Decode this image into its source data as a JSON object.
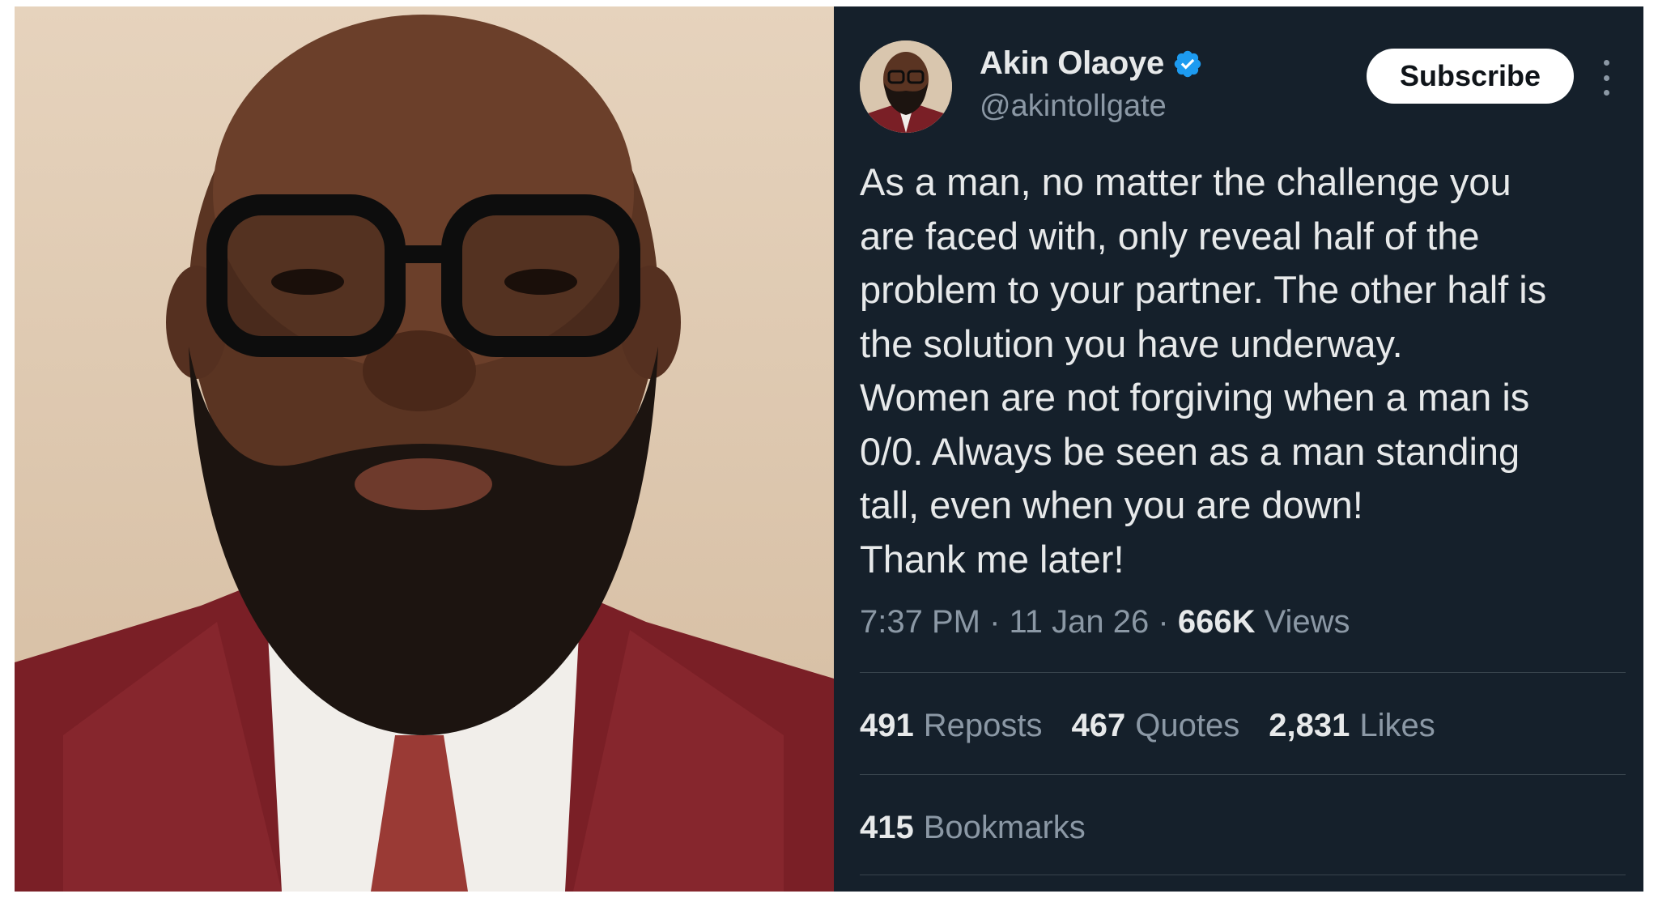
{
  "author": {
    "display_name": "Akin Olaoye",
    "handle": "@akintollgate",
    "verified_icon": "verified-badge-icon",
    "verified_color": "#1d9bf0"
  },
  "subscribe_label": "Subscribe",
  "tweet": {
    "lines": [
      "As a man, no matter the challenge you",
      "are faced with, only reveal half of the",
      "problem to your partner. The other half is",
      "the solution you have underway.",
      "Women are not forgiving when a man is",
      "0/0. Always be seen as a man standing",
      "tall, even when you are down!",
      "Thank me later!"
    ]
  },
  "meta": {
    "time": "7:37 PM",
    "date": "11 Jan 26",
    "separator": "·",
    "views_count": "666K",
    "views_label": "Views"
  },
  "stats": {
    "reposts_count": "491",
    "reposts_label": "Reposts",
    "quotes_count": "467",
    "quotes_label": "Quotes",
    "likes_count": "2,831",
    "likes_label": "Likes",
    "bookmarks_count": "415",
    "bookmarks_label": "Bookmarks"
  },
  "colors": {
    "background": "#15202b",
    "text": "#e7e9ea",
    "secondary_text": "#8b98a5",
    "divider": "#38444d",
    "subscribe_bg": "#ffffff"
  }
}
